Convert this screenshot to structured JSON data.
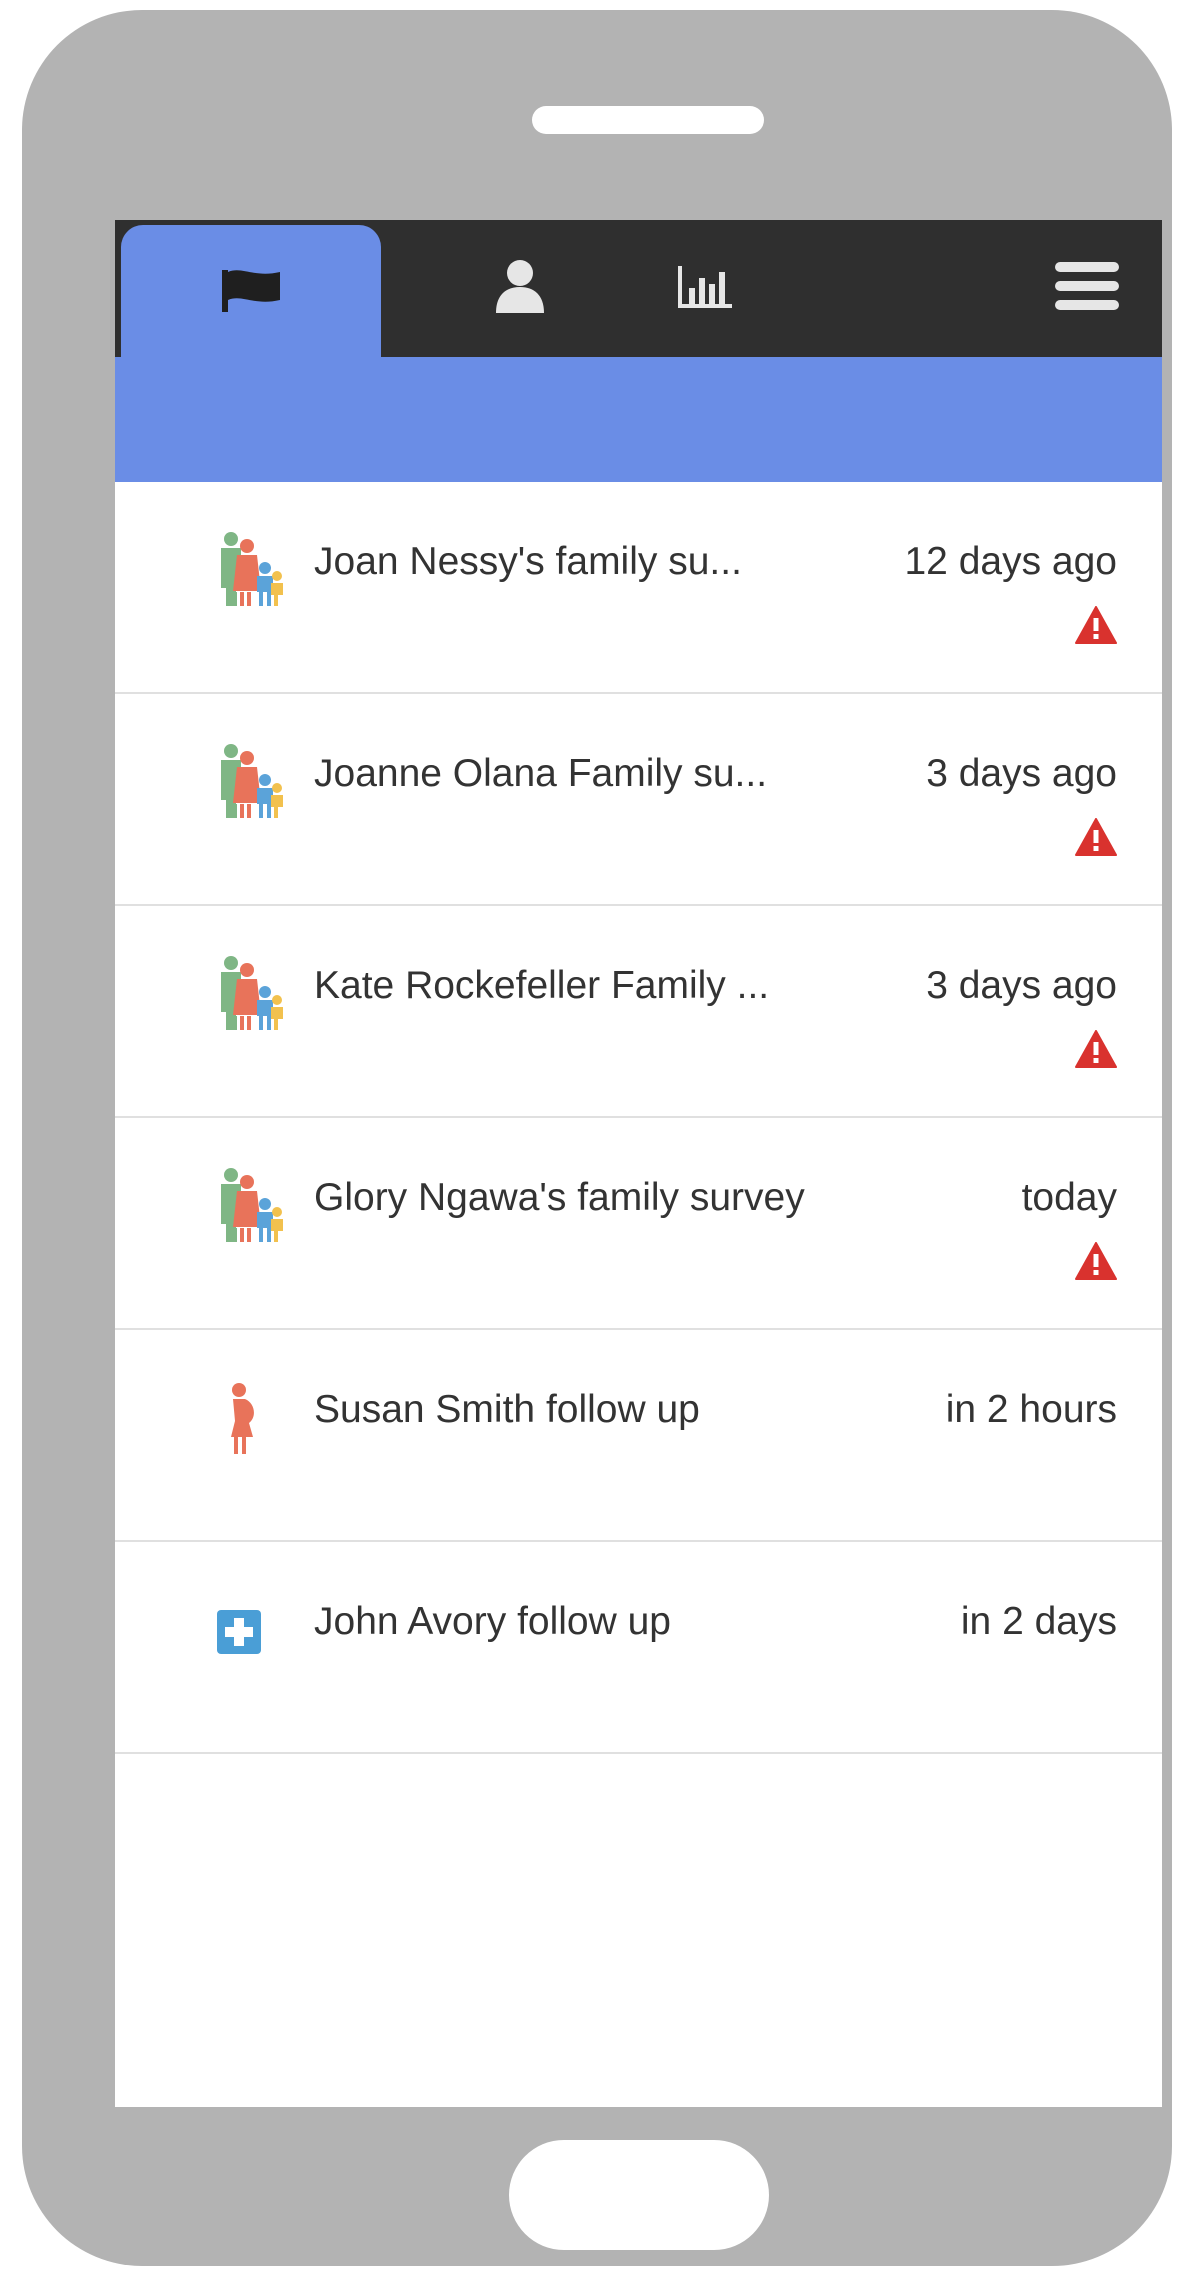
{
  "nav": {
    "tabs": [
      {
        "icon": "flag-icon",
        "active": true
      },
      {
        "icon": "person-icon",
        "active": false
      },
      {
        "icon": "bar-chart-icon",
        "active": false
      },
      {
        "icon": "hamburger-menu-icon",
        "active": false
      }
    ]
  },
  "colors": {
    "accent": "#6a8de6",
    "topbar": "#2f2f2f",
    "alert": "#d9322e",
    "phone_frame": "#b3b3b3"
  },
  "tasks": [
    {
      "icon": "family-icon",
      "title": "Joan Nessy's family su...",
      "time": "12 days ago",
      "alert": true
    },
    {
      "icon": "family-icon",
      "title": "Joanne Olana Family su...",
      "time": "3 days ago",
      "alert": true
    },
    {
      "icon": "family-icon",
      "title": "Kate Rockefeller Family ...",
      "time": "3 days ago",
      "alert": true
    },
    {
      "icon": "family-icon",
      "title": "Glory Ngawa's family survey",
      "time": "today",
      "alert": true
    },
    {
      "icon": "pregnant-woman-icon",
      "title": "Susan Smith follow up",
      "time": "in 2 hours",
      "alert": false
    },
    {
      "icon": "medical-cross-icon",
      "title": "John Avory follow up",
      "time": "in 2 days",
      "alert": false
    }
  ]
}
